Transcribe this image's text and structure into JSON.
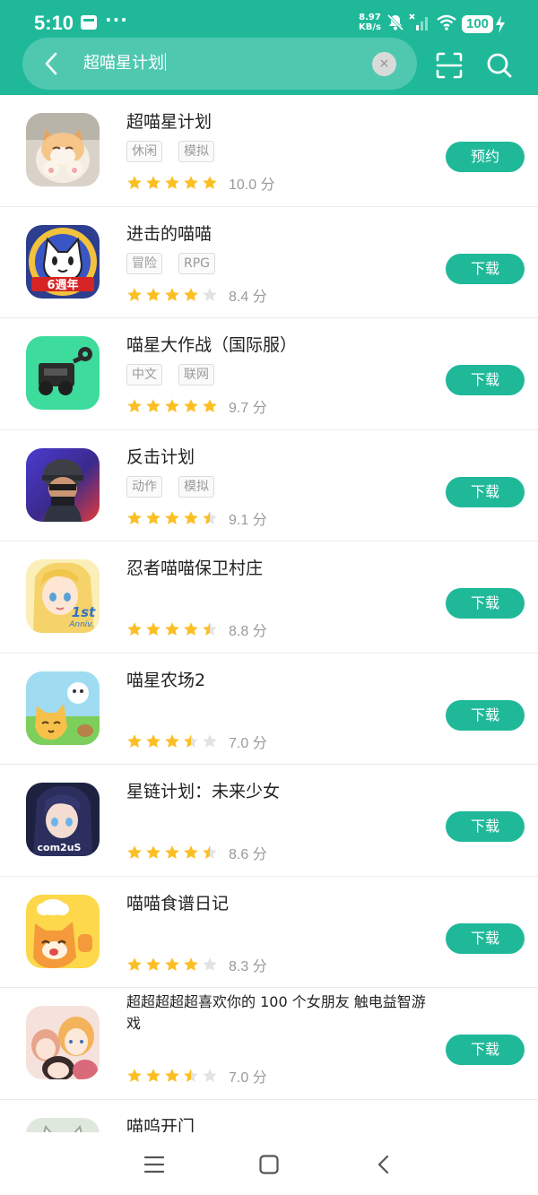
{
  "status_bar": {
    "time": "5:10",
    "dots": "···",
    "speed_value": "8.97",
    "speed_unit": "KB/s",
    "battery": "100"
  },
  "search": {
    "query": "超喵星计划",
    "clear_glyph": "×"
  },
  "colors": {
    "brand": "#1fb99a",
    "star_on": "#fbbf24",
    "star_off": "#e3e3e3"
  },
  "apps": [
    {
      "name": "超喵星计划",
      "tags": [
        "休闲",
        "模拟"
      ],
      "rating": 5,
      "score_text": "10.0 分",
      "button": "预约"
    },
    {
      "name": "进击的喵喵",
      "tags": [
        "冒险",
        "RPG"
      ],
      "rating": 4,
      "score_text": "8.4 分",
      "button": "下载"
    },
    {
      "name": "喵星大作战（国际服）",
      "tags": [
        "中文",
        "联网"
      ],
      "rating": 5,
      "score_text": "9.7 分",
      "button": "下载"
    },
    {
      "name": "反击计划",
      "tags": [
        "动作",
        "模拟"
      ],
      "rating": 4.5,
      "score_text": "9.1 分",
      "button": "下载"
    },
    {
      "name": "忍者喵喵保卫村庄",
      "tags": [],
      "rating": 4.5,
      "score_text": "8.8 分",
      "button": "下载"
    },
    {
      "name": "喵星农场2",
      "tags": [],
      "rating": 3.5,
      "score_text": "7.0 分",
      "button": "下载"
    },
    {
      "name": "星链计划：未来少女",
      "tags": [],
      "rating": 4.5,
      "score_text": "8.6 分",
      "button": "下载"
    },
    {
      "name": "喵喵食谱日记",
      "tags": [],
      "rating": 4,
      "score_text": "8.3 分",
      "button": "下载"
    },
    {
      "name": "超超超超超喜欢你的 100 个女朋友 触电益智游戏",
      "tags": [],
      "rating": 3.5,
      "score_text": "7.0 分",
      "button": "下载"
    },
    {
      "name": "喵呜开门",
      "tags": [],
      "rating": 0,
      "score_text": "",
      "button": ""
    }
  ],
  "icon_labels": {
    "anniv6": "6週年",
    "firstanniv_1": "1st",
    "firstanniv_2": "Anniv.",
    "com2us": "com2uS"
  },
  "icons": {
    "back": "chevron-left-icon",
    "scan": "scan-icon",
    "search": "search-icon",
    "menu": "menu-icon",
    "home": "home-square-icon",
    "nav_back": "back-icon"
  }
}
